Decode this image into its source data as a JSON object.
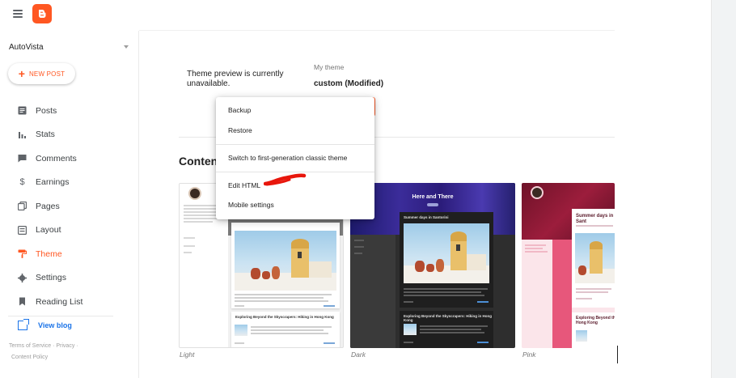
{
  "header": {
    "menu_icon": "hamburger-menu-icon",
    "logo_icon": "blogger-logo-icon",
    "brand_color": "#ff5722"
  },
  "sidebar": {
    "blog_name": "AutoVista",
    "new_post_label": "NEW POST",
    "items": [
      {
        "label": "Posts",
        "icon": "posts-icon"
      },
      {
        "label": "Stats",
        "icon": "stats-icon"
      },
      {
        "label": "Comments",
        "icon": "comments-icon"
      },
      {
        "label": "Earnings",
        "icon": "dollar-icon"
      },
      {
        "label": "Pages",
        "icon": "pages-icon"
      },
      {
        "label": "Layout",
        "icon": "layout-icon"
      },
      {
        "label": "Theme",
        "icon": "paint-roller-icon",
        "active": true
      },
      {
        "label": "Settings",
        "icon": "gear-icon"
      },
      {
        "label": "Reading List",
        "icon": "bookmark-icon"
      }
    ],
    "view_blog_label": "View blog",
    "footer": {
      "terms": "Terms of Service",
      "sep": "·",
      "privacy": "Privacy",
      "sep2": "·",
      "content_policy": "Content Policy"
    }
  },
  "main": {
    "preview_message": "Theme preview is currently unavailable.",
    "my_theme_label": "My theme",
    "my_theme_name": "custom (Modified)",
    "section_title": "Content"
  },
  "menu": {
    "items": [
      "Backup",
      "Restore",
      "Switch to first-generation classic theme",
      "Edit HTML",
      "Mobile settings"
    ]
  },
  "themes": [
    {
      "caption": "Light",
      "post_title": "Exploring Beyond the Skyscrapers: Hiking in Hong Kong"
    },
    {
      "caption": "Dark",
      "header_title": "Here and There",
      "post_heading": "Summer days in Santorini",
      "post_title": "Exploring Beyond the Skyscrapers: Hiking in Hong Kong"
    },
    {
      "caption": "Pink",
      "post_heading": "Summer days in Sant",
      "post_title": "Exploring Beyond the Hong Kong"
    }
  ]
}
